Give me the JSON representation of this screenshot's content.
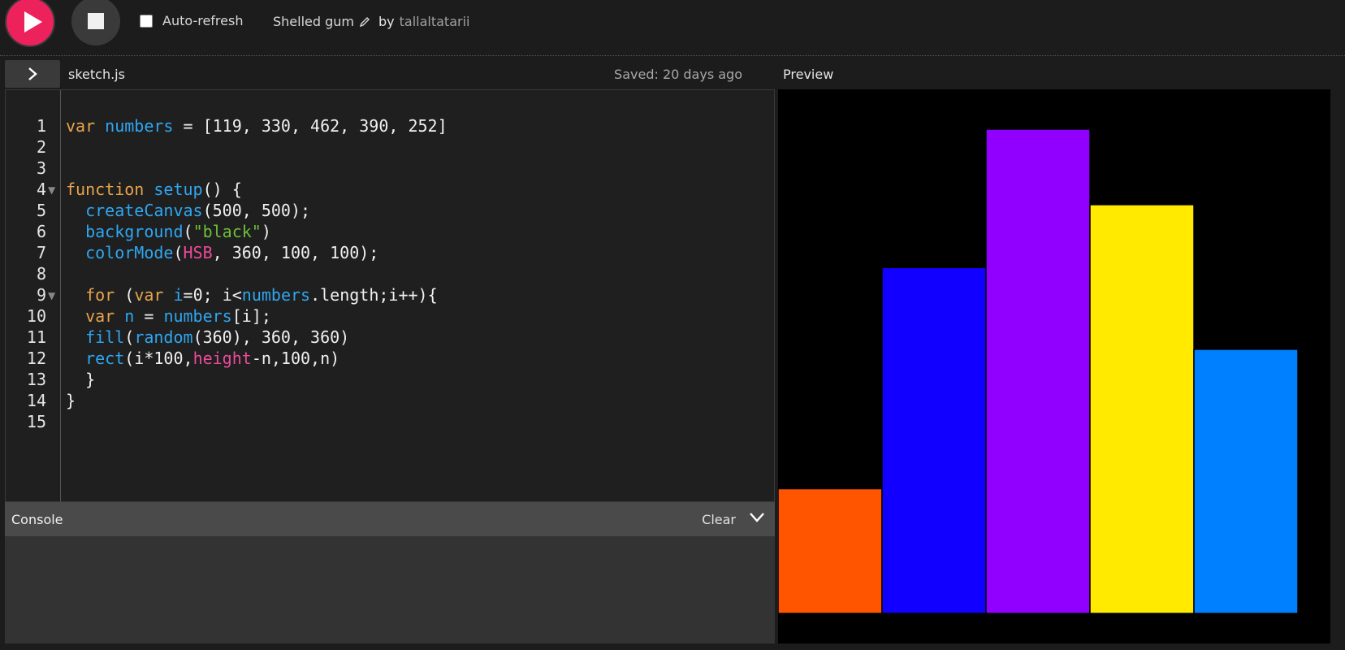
{
  "toolbar": {
    "play_label": "play",
    "stop_label": "stop",
    "auto_refresh_label": "Auto-refresh",
    "auto_refresh_checked": false,
    "sketch_title": "Shelled gum",
    "by_label": "by",
    "author": "tallaltatarii"
  },
  "editor": {
    "file_name": "sketch.js",
    "saved_status": "Saved: 20 days ago",
    "line_numbers": [
      "1",
      "2",
      "3",
      "4",
      "5",
      "6",
      "7",
      "8",
      "9",
      "10",
      "11",
      "12",
      "13",
      "14",
      "15"
    ],
    "folded_lines": [
      "4",
      "9"
    ]
  },
  "preview": {
    "label": "Preview",
    "canvas_background": "#000000",
    "bars": [
      {
        "value": 119,
        "color": "#ff5500"
      },
      {
        "value": 330,
        "color": "#1100ff"
      },
      {
        "value": 462,
        "color": "#9100ff"
      },
      {
        "value": 390,
        "color": "#ffea00"
      },
      {
        "value": 252,
        "color": "#0080ff"
      }
    ],
    "canvas_height_units": 500
  },
  "console": {
    "title": "Console",
    "clear_label": "Clear"
  },
  "colors": {
    "accent": "#ed225d",
    "keyword": "#e8a44c",
    "identifier": "#2fa6f0",
    "string": "#6ebf3a",
    "constant": "#ed4a9a"
  }
}
